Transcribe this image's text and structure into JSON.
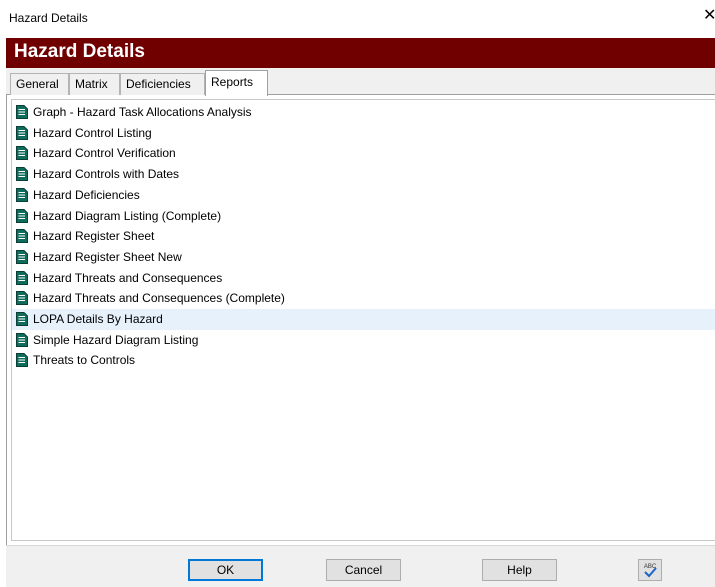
{
  "window": {
    "title": "Hazard Details",
    "close_glyph": "✕"
  },
  "banner": {
    "title": "Hazard Details"
  },
  "tabs": [
    {
      "label": "General"
    },
    {
      "label": "Matrix"
    },
    {
      "label": "Deficiencies"
    },
    {
      "label": "Reports",
      "active": true
    }
  ],
  "reports": {
    "selected_index": 10,
    "items": [
      {
        "label": "Graph - Hazard Task Allocations Analysis",
        "icon": "report-document-icon"
      },
      {
        "label": "Hazard Control Listing",
        "icon": "report-document-icon"
      },
      {
        "label": "Hazard Control Verification",
        "icon": "report-document-icon"
      },
      {
        "label": "Hazard Controls with Dates",
        "icon": "report-document-icon"
      },
      {
        "label": "Hazard Deficiencies",
        "icon": "report-document-icon"
      },
      {
        "label": "Hazard Diagram Listing (Complete)",
        "icon": "report-document-icon"
      },
      {
        "label": "Hazard Register Sheet",
        "icon": "report-document-icon"
      },
      {
        "label": "Hazard Register Sheet New",
        "icon": "report-document-icon"
      },
      {
        "label": "Hazard Threats and Consequences",
        "icon": "report-document-icon"
      },
      {
        "label": "Hazard Threats and Consequences (Complete)",
        "icon": "report-document-icon"
      },
      {
        "label": "LOPA Details By Hazard",
        "icon": "report-document-icon"
      },
      {
        "label": "Simple Hazard Diagram Listing",
        "icon": "report-document-icon"
      },
      {
        "label": "Threats to Controls",
        "icon": "report-document-icon"
      }
    ]
  },
  "footer": {
    "ok_label": "OK",
    "cancel_label": "Cancel",
    "help_label": "Help",
    "spell_icon": "spell-check-icon",
    "spell_text": "ABC"
  },
  "colors": {
    "banner": "#700000",
    "selection": "#e7f1fb",
    "icon_fill": "#0f6b5c",
    "default_button_border": "#0078d7"
  }
}
